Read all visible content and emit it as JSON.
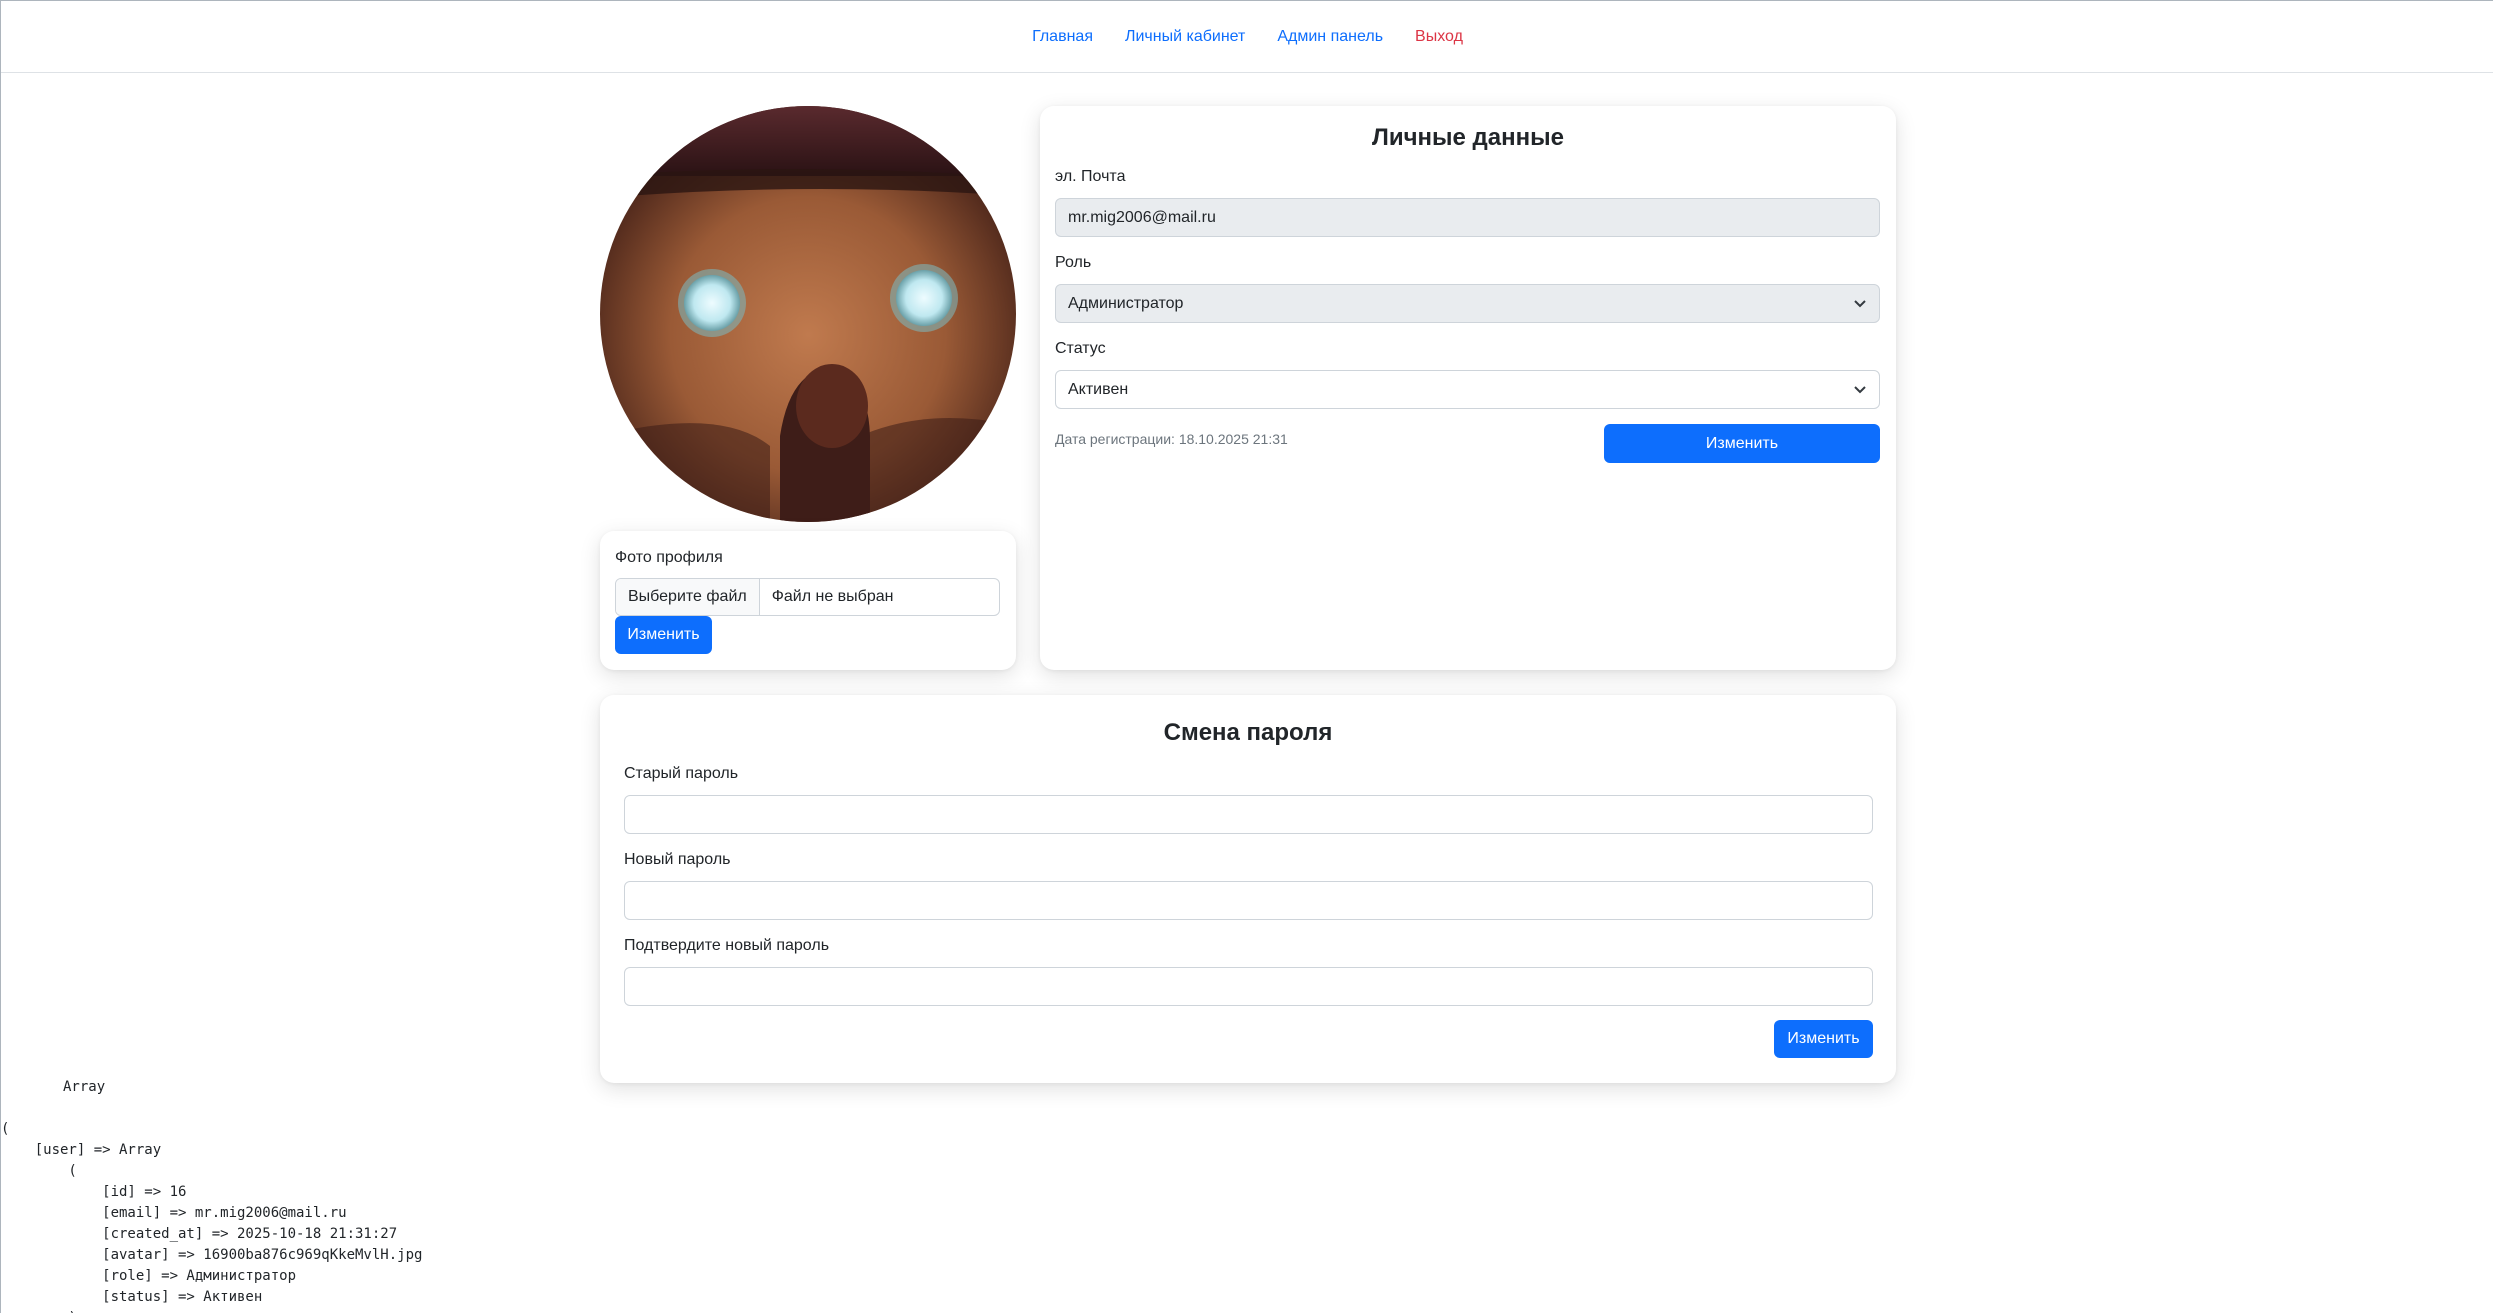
{
  "nav": {
    "home": "Главная",
    "cabinet": "Личный кабинет",
    "admin": "Админ панель",
    "logout": "Выход"
  },
  "photo": {
    "label": "Фото профиля",
    "choose_file": "Выберите файл",
    "no_file": "Файл не выбран",
    "submit": "Изменить"
  },
  "personal": {
    "title": "Личные данные",
    "email_label": "эл. Почта",
    "email_value": "mr.mig2006@mail.ru",
    "role_label": "Роль",
    "role_value": "Администратор",
    "status_label": "Статус",
    "status_value": "Активен",
    "reg_date": "Дата регистрации: 18.10.2025 21:31",
    "submit": "Изменить"
  },
  "password": {
    "title": "Смена пароля",
    "old_label": "Старый пароль",
    "new_label": "Новый пароль",
    "confirm_label": "Подтвердите новый пароль",
    "submit": "Изменить"
  },
  "debug": {
    "line1": "Array",
    "line2": "(",
    "line3": "    [user] => Array",
    "line4": "        (",
    "line5": "            [id] => 16",
    "line6": "            [email] => mr.mig2006@mail.ru",
    "line7": "            [created_at] => 2025-10-18 21:31:27",
    "line8": "            [avatar] => 16900ba876c969qKkeMvlH.jpg",
    "line9": "            [role] => Администратор",
    "line10": "            [status] => Активен",
    "line11": "        )"
  },
  "colors": {
    "primary": "#0d6efd",
    "danger": "#dc3545",
    "disabled_bg": "#e9ecef"
  }
}
